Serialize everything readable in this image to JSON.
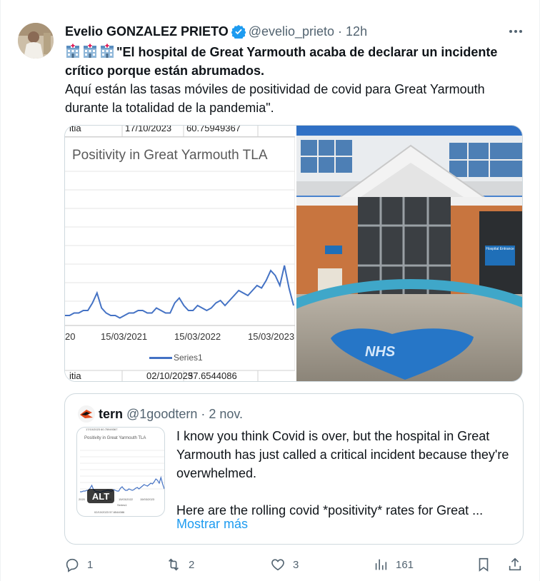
{
  "author": {
    "name": "Evelio GONZALEZ PRIETO",
    "handle": "@evelio_prieto",
    "separator": "·",
    "time": "12h",
    "verified_color": "#1d9bf0"
  },
  "post": {
    "bold_text": "\"El hospital de Great Yarmouth acaba de declarar un incidente crítico porque están abrumados.",
    "body_text": "Aquí están las tasas móviles de positividad de covid para Great Yarmouth durante la totalidad de la pandemia\"."
  },
  "media": {
    "sheet_top": [
      "itia",
      "17/10/2023",
      "60.75949367"
    ],
    "sheet_bottom": [
      "itia",
      "02/10/2023",
      "57.6544086"
    ],
    "chart_data": {
      "type": "line",
      "title": "Positivity in Great Yarmouth TLA",
      "x_tick_labels": [
        "20",
        "15/03/2021",
        "15/03/2022",
        "15/03/2023"
      ],
      "series": [
        {
          "name": "Series1",
          "color": "#4472c4",
          "values": [
            4,
            4,
            5,
            5,
            6,
            6,
            9,
            13,
            7,
            5,
            4,
            4,
            3,
            4,
            5,
            5,
            6,
            6,
            5,
            5,
            7,
            6,
            5,
            5,
            9,
            11,
            8,
            6,
            6,
            8,
            7,
            6,
            7,
            9,
            10,
            8,
            10,
            12,
            14,
            13,
            12,
            14,
            16,
            15,
            18,
            22,
            20,
            16,
            24,
            15,
            8
          ]
        }
      ],
      "grid": true,
      "legend": "bottom"
    },
    "photo_sign": "NHS",
    "door_sign": "Hospital Entrance"
  },
  "quote": {
    "name": "tern",
    "handle": "@1goodtern",
    "separator": "·",
    "time": "2 nov.",
    "text_1": "I know you think Covid is over, but the hospital in Great Yarmouth has just called a critical incident because they're overwhelmed.",
    "text_2": "Here are the rolling covid *positivity* rates for Great ...",
    "show_more": "Mostrar más",
    "alt_badge": "ALT",
    "thumb_title": "Positivity in Great Yarmouth TLA",
    "thumb_sheet_top": "17/10/2023 60.75949367",
    "thumb_sheet_bottom": "02/10/2023 57.6544086",
    "thumb_ticks": [
      "2020",
      "15/03/2021",
      "15/03/2022",
      "15/03/2023"
    ],
    "thumb_legend": "Series1"
  },
  "actions": {
    "replies": "1",
    "reposts": "2",
    "likes": "3",
    "views": "161",
    "repost_color": "#536471"
  }
}
